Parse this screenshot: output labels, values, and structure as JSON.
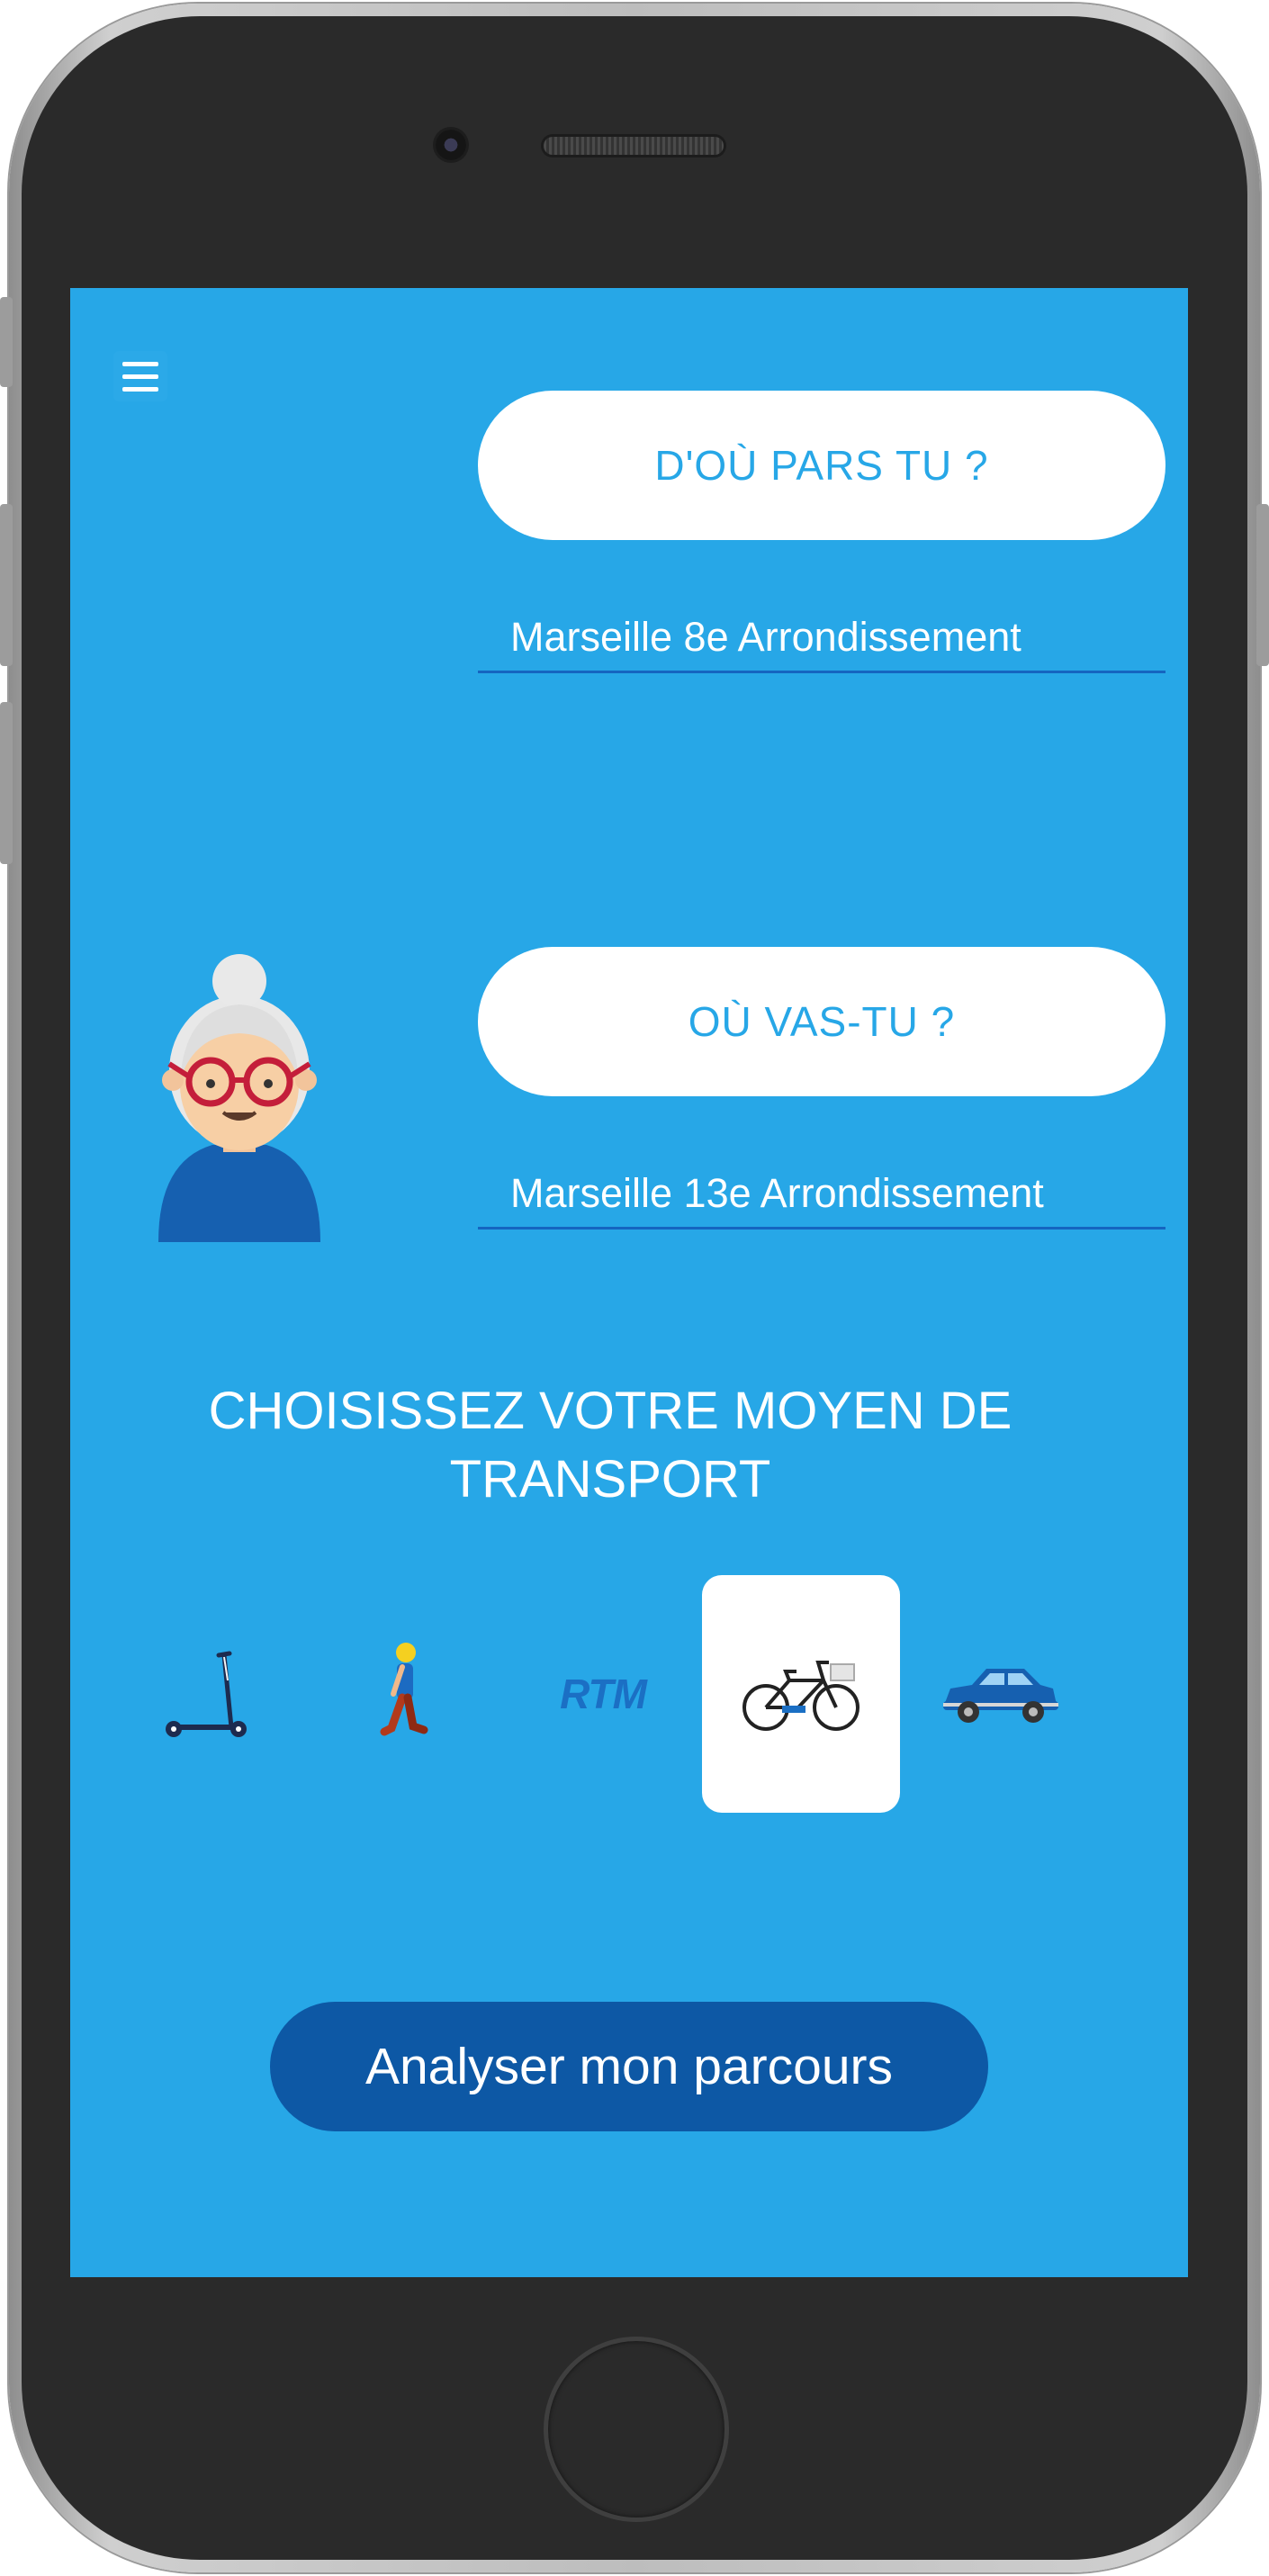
{
  "menu": {
    "icon": "hamburger-icon"
  },
  "origin": {
    "button_label": "D'OÙ PARS TU ?",
    "value": "Marseille 8e Arrondissement"
  },
  "destination": {
    "button_label": "OÙ VAS-TU ?",
    "value": "Marseille 13e Arrondissement"
  },
  "transport": {
    "heading_line1": "CHOISISSEZ VOTRE MOYEN DE",
    "heading_line2": "TRANSPORT",
    "modes": [
      {
        "icon": "scooter-icon",
        "selected": false
      },
      {
        "icon": "walking-person-icon",
        "selected": false
      },
      {
        "icon": "rtm-logo",
        "label": "RTM",
        "selected": false
      },
      {
        "icon": "bicycle-icon",
        "selected": true
      },
      {
        "icon": "car-icon",
        "selected": false
      }
    ]
  },
  "action": {
    "analyse_label": "Analyser mon parcours"
  },
  "colors": {
    "screen_bg": "#27a7e7",
    "accent_dark": "#0d58a5",
    "pill_text": "#27a7e7"
  }
}
